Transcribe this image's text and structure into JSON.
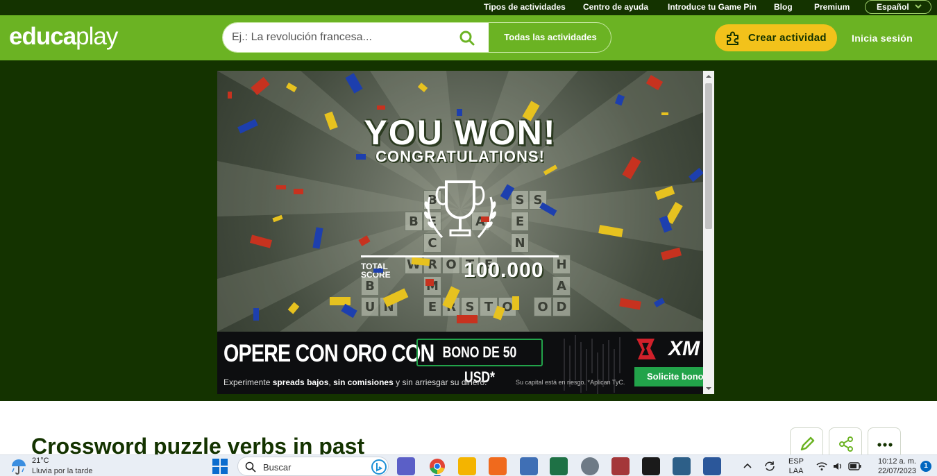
{
  "topnav": {
    "items": [
      "Tipos de actividades",
      "Centro de ayuda",
      "Introduce tu Game Pin",
      "Blog",
      "Premium"
    ],
    "language": "Español"
  },
  "header": {
    "logo_main": "educa",
    "logo_light": "play",
    "search_placeholder": "Ej.: La revolución francesa...",
    "all_activities": "Todas las actividades",
    "create_activity": "Crear actividad",
    "login": "Inicia sesión",
    "brand_color": "#6bb323",
    "dark_color": "#143300",
    "accent_color": "#f2c21b"
  },
  "ad": {
    "headline": "YOU WON!",
    "subheadline": "CONGRATULATIONS!",
    "score_label_1": "TOTAL",
    "score_label_2": "SCORE",
    "score_value": "100.000",
    "tiles": [
      "B",
      "S",
      "S",
      "B",
      "E",
      "A",
      "E",
      "C",
      "N",
      "W",
      "R",
      "O",
      "T",
      "E",
      "H",
      "B",
      "M",
      "A",
      "U",
      "N",
      "E",
      "R",
      "S",
      "T",
      "O",
      "O",
      "D"
    ],
    "banner_headline": "OPERE CON ORO CON",
    "banner_bonus": "BONO DE 50 USD*",
    "banner_sub_1": "Experimente ",
    "banner_sub_bold_1": "spreads bajos",
    "banner_sub_2": ", ",
    "banner_sub_bold_2": "sin comisiones",
    "banner_sub_3": " y sin arriesgar su dinero.",
    "banner_risk": "Su capital está en riesgo. *Aplican TyC.",
    "banner_brand": "XM",
    "banner_cta": "Solicite bono"
  },
  "page": {
    "title": "Crossword puzzle verbs in past"
  },
  "taskbar": {
    "weather_temp": "21°C",
    "weather_desc": "Lluvia por la tarde",
    "search_label": "Buscar",
    "lang_1": "ESP",
    "lang_2": "LAA",
    "time": "10:12 a. m.",
    "date": "22/07/2023",
    "notifications": "1"
  }
}
